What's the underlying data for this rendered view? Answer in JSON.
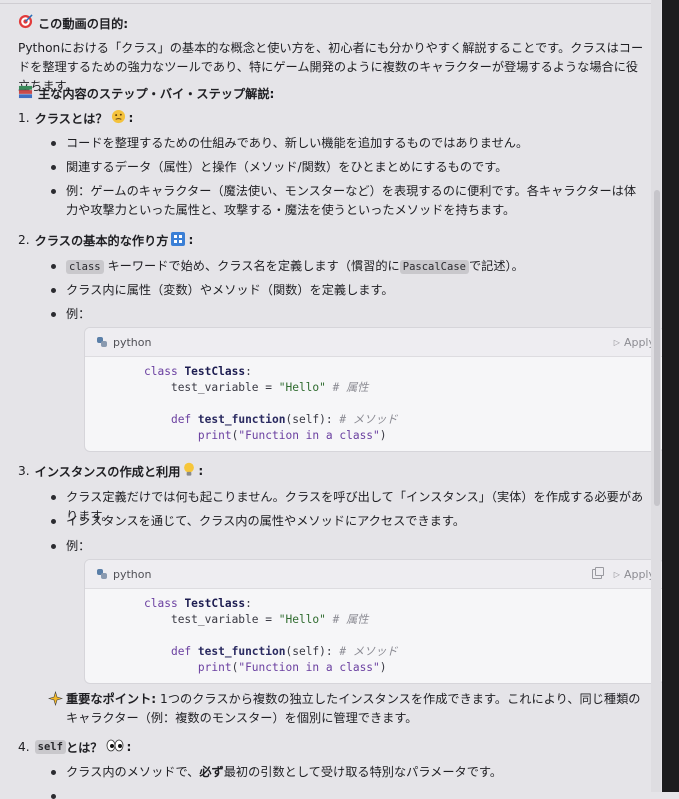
{
  "purpose": {
    "icon": "dart-target-icon",
    "heading": "この動画の目的:",
    "text": "Pythonにおける「クラス」の基本的な概念と使い方を、初心者にも分かりやすく解説することです。クラスはコードを整理するための強力なツールであり、特にゲーム開発のように複数のキャラクターが登場するような場合に役立ちます。"
  },
  "steps": {
    "icon": "books-icon",
    "heading": "主な内容のステップ・バイ・ステップ解説:"
  },
  "section1": {
    "number": "1.",
    "title": "クラスとは？",
    "icon": "thinking-face-icon",
    "colon": ":",
    "bullets": [
      "コードを整理するための仕組みであり、新しい機能を追加するものではありません。",
      "関連するデータ（属性）と操作（メソッド/関数）をひとまとめにするものです。",
      "例：ゲームのキャラクター（魔法使い、モンスターなど）を表現するのに便利です。各キャラクターは体力や攻撃力といった属性と、攻撃する・魔法を使うといったメソッドを持ちます。"
    ]
  },
  "section2": {
    "number": "2.",
    "title": "クラスの基本的な作り方",
    "icon": "building-blocks-icon",
    "colon": ":",
    "bullet1": {
      "code1": "class",
      "text1": " キーワードで始め、クラス名を定義します（慣習的に",
      "code2": "PascalCase",
      "text2": "で記述）。"
    },
    "bullet2": "クラス内に属性（変数）やメソッド（関数）を定義します。",
    "bullet3": "例：",
    "code": {
      "language": "python",
      "apply": "Apply",
      "line1_kw": "class",
      "line1_name": "TestClass",
      "line1_end": ":",
      "line2_var": "test_variable = ",
      "line2_str": "\"Hello\"",
      "line2_cmt": "# 属性",
      "line4_kw": "def",
      "line4_name": "test_function",
      "line4_args": "(self):",
      "line4_cmt": "# メソッド",
      "line5_fn": "print",
      "line5_open": "(",
      "line5_str": "\"Function in a class\"",
      "line5_close": ")"
    }
  },
  "section3": {
    "number": "3.",
    "title": "インスタンスの作成と利用",
    "icon": "light-bulb-icon",
    "colon": ":",
    "bullets": [
      "クラス定義だけでは何も起こりません。クラスを呼び出して「インスタンス」（実体）を作成する必要があります。",
      "インスタンスを通じて、クラス内の属性やメソッドにアクセスできます。",
      "例："
    ],
    "code": {
      "language": "python",
      "apply": "Apply",
      "line1_kw": "class",
      "line1_name": "TestClass",
      "line1_end": ":",
      "line2_var": "test_variable = ",
      "line2_str": "\"Hello\"",
      "line2_cmt": "# 属性",
      "line4_kw": "def",
      "line4_name": "test_function",
      "line4_args": "(self):",
      "line4_cmt": "# メソッド",
      "line5_fn": "print",
      "line5_open": "(",
      "line5_str": "\"Function in a class\"",
      "line5_close": ")"
    },
    "point": {
      "icon": "sparkles-icon",
      "label": "重要なポイント:",
      "text": " 1つのクラスから複数の独立したインスタンスを作成できます。これにより、同じ種類のキャラクター（例：複数のモンスター）を個別に管理できます。"
    }
  },
  "section4": {
    "number": "4.",
    "code": "self",
    "title": " とは？",
    "icon": "eyes-icon",
    "colon": ":",
    "bullet1_a": "クラス内のメソッドで、",
    "bullet1_bold": "必ず",
    "bullet1_b": "最初の引数として受け取る特別なパラメータです。"
  }
}
